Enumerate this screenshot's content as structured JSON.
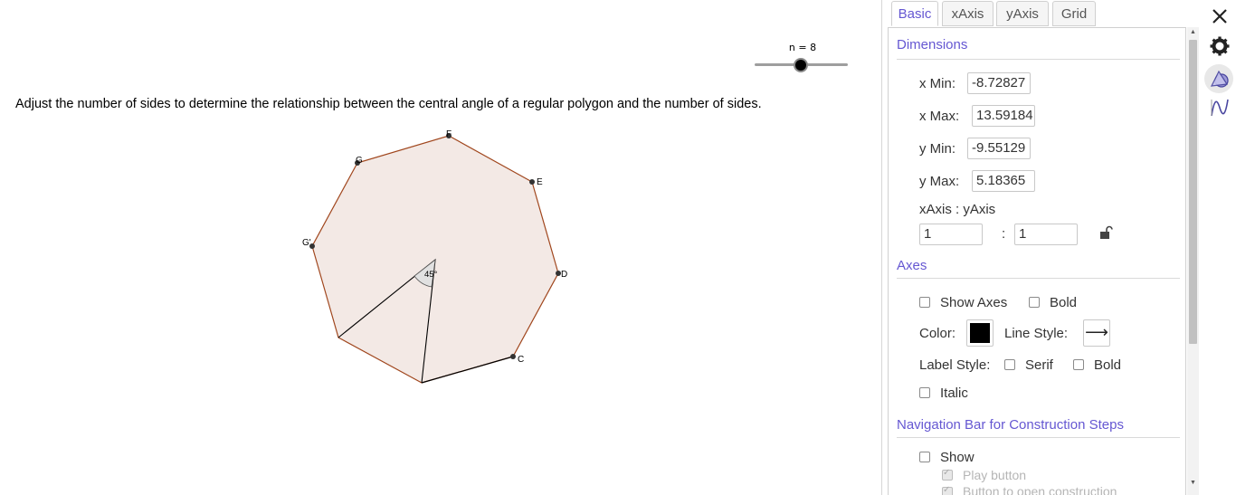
{
  "graphics": {
    "slider": {
      "label": "n = 8",
      "value": 8
    },
    "instruction": "Adjust the number of sides to determine the relationship between the central angle of a regular polygon and the number of sides.",
    "polygon": {
      "vertex_labels": [
        "C",
        "D",
        "E",
        "F",
        "G",
        "G'"
      ],
      "angle_label": "45°",
      "fill_color": "#f3e9e5",
      "edge_color": "#a0461d"
    }
  },
  "properties": {
    "tabs": [
      "Basic",
      "xAxis",
      "yAxis",
      "Grid"
    ],
    "active_tab": "Basic",
    "dimensions": {
      "title": "Dimensions",
      "x_min_label": "x Min:",
      "x_min_value": "-8.72827",
      "x_max_label": "x Max:",
      "x_max_value": "13.59184",
      "y_min_label": "y Min:",
      "y_min_value": "-9.55129",
      "y_max_label": "y Max:",
      "y_max_value": "5.18365",
      "ratio_label": "xAxis : yAxis",
      "ratio_x": "1",
      "ratio_sep": ":",
      "ratio_y": "1"
    },
    "axes": {
      "title": "Axes",
      "show_axes_label": "Show Axes",
      "show_axes": false,
      "bold_label": "Bold",
      "bold": false,
      "color_label": "Color:",
      "color_value": "#000000",
      "line_style_label": "Line Style:",
      "line_style_glyph": "⟶",
      "label_style_label": "Label Style:",
      "serif_label": "Serif",
      "label_bold_label": "Bold",
      "italic_label": "Italic"
    },
    "navigation": {
      "title": "Navigation Bar for Construction Steps",
      "show_label": "Show",
      "play_button_label": "Play button",
      "open_construction_label": "Button to open construction"
    }
  },
  "accent_color": "#6557d2"
}
